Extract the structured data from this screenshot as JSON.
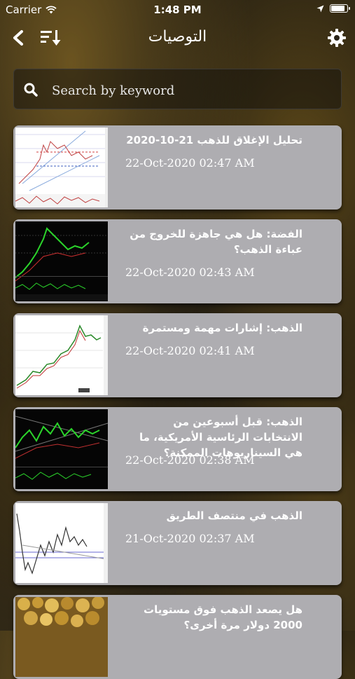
{
  "status_bar": {
    "carrier": "Carrier",
    "time": "1:48 PM",
    "battery_level": 0.9
  },
  "nav": {
    "title": "التوصيات",
    "back_icon": "chevron-left-icon",
    "sort_icon": "sort-descending-icon",
    "settings_icon": "gear-icon"
  },
  "search": {
    "placeholder": "Search by keyword",
    "value": ""
  },
  "articles": [
    {
      "title": "تحليل الإغلاق للذهب 21-10-2020",
      "date": "22-Oct-2020 02:47 AM",
      "thumb": "light-chart"
    },
    {
      "title": "الفضة: هل هي جاهزة للخروج من عباءة الذهب؟",
      "date": "22-Oct-2020 02:43 AM",
      "thumb": "dark-chart"
    },
    {
      "title": "الذهب: إشارات مهمة ومستمرة",
      "date": "22-Oct-2020 02:41 AM",
      "thumb": "light-chart"
    },
    {
      "title": "الذهب: قبل أسبوعين من الانتخابات الرئاسية الأمريكية، ما هي السيناريوهات الممكنة؟",
      "date": "22-Oct-2020 02:38 AM",
      "thumb": "dark-chart"
    },
    {
      "title": "الذهب في منتصف الطريق",
      "date": "21-Oct-2020 02:37 AM",
      "thumb": "light-chart"
    },
    {
      "title": "هل يصعد الذهب فوق مستويات 2000 دولار مرة أخرى؟",
      "date": "",
      "thumb": "gold-nuggets"
    }
  ]
}
